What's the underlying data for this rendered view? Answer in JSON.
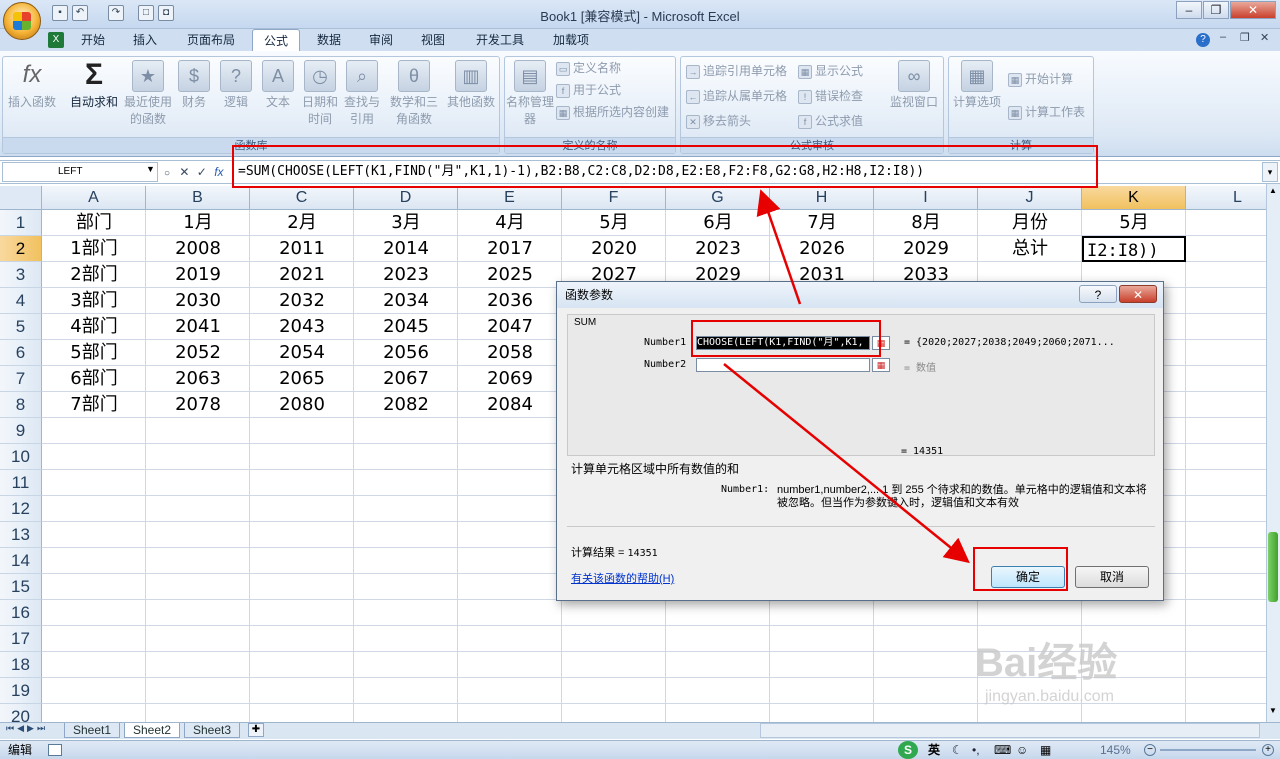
{
  "window": {
    "title": "Book1  [兼容模式] - Microsoft Excel"
  },
  "tabs": [
    "开始",
    "插入",
    "页面布局",
    "公式",
    "数据",
    "审阅",
    "视图",
    "开发工具",
    "加载项"
  ],
  "ribbon": {
    "insert_function": "插入函数",
    "autosum": "自动求和",
    "recent": "最近使用的函数",
    "financial": "财务",
    "logical": "逻辑",
    "text": "文本",
    "datetime": "日期和时间",
    "lookup": "查找与引用",
    "math": "数学和三角函数",
    "other": "其他函数",
    "name_manager": "名称管理器",
    "define_name": "定义名称",
    "use_in_formula": "用于公式",
    "create_from_selection": "根据所选内容创建",
    "trace_precedents": "追踪引用单元格",
    "trace_dependents": "追踪从属单元格",
    "remove_arrows": "移去箭头",
    "show_formulas": "显示公式",
    "error_checking": "错误检查",
    "evaluate_formula": "公式求值",
    "watch_window": "监视窗口",
    "calc_options": "计算选项",
    "calc_now": "开始计算",
    "calc_sheet": "计算工作表",
    "group_library": "函数库",
    "group_names": "定义的名称",
    "group_audit": "公式审核",
    "group_calc": "计算"
  },
  "formula_bar": {
    "name_box": "LEFT",
    "formula": "=SUM(CHOOSE(LEFT(K1,FIND(\"月\",K1,1)-1),B2:B8,C2:C8,D2:D8,E2:E8,F2:F8,G2:G8,H2:H8,I2:I8))"
  },
  "columns": [
    "A",
    "B",
    "C",
    "D",
    "E",
    "F",
    "G",
    "H",
    "I",
    "J",
    "K",
    "L"
  ],
  "rows": [
    "1",
    "2",
    "3",
    "4",
    "5",
    "6",
    "7",
    "8",
    "9",
    "10",
    "11",
    "12",
    "13",
    "14",
    "15",
    "16",
    "17",
    "18",
    "19",
    "20"
  ],
  "cells": [
    [
      "部门",
      "1月",
      "2月",
      "3月",
      "4月",
      "5月",
      "6月",
      "7月",
      "8月",
      "月份",
      "5月"
    ],
    [
      "1部门",
      "2008",
      "2011",
      "2014",
      "2017",
      "2020",
      "2023",
      "2026",
      "2029",
      "总计",
      "I2:I8))"
    ],
    [
      "2部门",
      "2019",
      "2021",
      "2023",
      "2025",
      "2027",
      "2029",
      "2031",
      "2033",
      "",
      ""
    ],
    [
      "3部门",
      "2030",
      "2032",
      "2034",
      "2036",
      "",
      "",
      "",
      "",
      "",
      ""
    ],
    [
      "4部门",
      "2041",
      "2043",
      "2045",
      "2047",
      "",
      "",
      "",
      "",
      "",
      ""
    ],
    [
      "5部门",
      "2052",
      "2054",
      "2056",
      "2058",
      "",
      "",
      "",
      "",
      "",
      ""
    ],
    [
      "6部门",
      "2063",
      "2065",
      "2067",
      "2069",
      "",
      "",
      "",
      "",
      "",
      ""
    ],
    [
      "7部门",
      "2078",
      "2080",
      "2082",
      "2084",
      "",
      "",
      "",
      "",
      "",
      ""
    ]
  ],
  "sheet_tabs": [
    "Sheet1",
    "Sheet2",
    "Sheet3"
  ],
  "status": {
    "mode": "编辑",
    "zoom": "145%",
    "ime": "英"
  },
  "dialog": {
    "title": "函数参数",
    "function_name": "SUM",
    "arg1_label": "Number1",
    "arg1_value": "CHOOSE(LEFT(K1,FIND(\"月\",K1,",
    "arg1_result": "= {2020;2027;2038;2049;2060;2071...",
    "arg2_label": "Number2",
    "arg2_result": "= 数值",
    "total": "= 14351",
    "description": "计算单元格区域中所有数值的和",
    "arg_help_label": "Number1:",
    "arg_help": "number1,number2,... 1 到 255 个待求和的数值。单元格中的逻辑值和文本将被忽略。但当作为参数键入时，逻辑值和文本有效",
    "result_label": "计算结果 = ",
    "result_value": "14351",
    "help_link": "有关该函数的帮助(H)",
    "ok": "确定",
    "cancel": "取消"
  },
  "watermark": {
    "text": "Bai经验",
    "url": "jingyan.baidu.com"
  },
  "colors": {
    "highlight": "#e60000",
    "selected_header": "#f1c15f"
  }
}
